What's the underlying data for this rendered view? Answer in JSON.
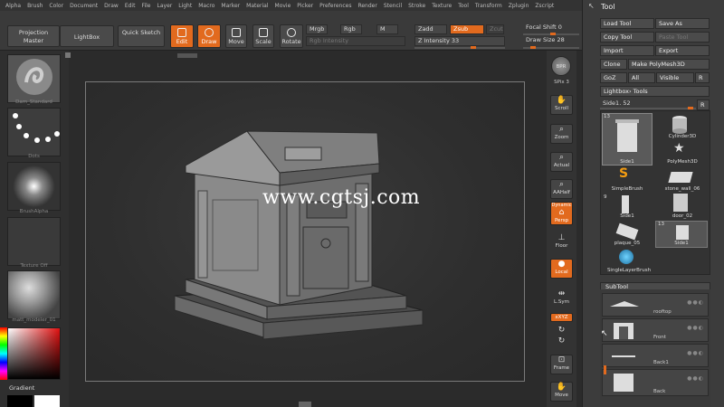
{
  "menu": [
    "Alpha",
    "Brush",
    "Color",
    "Document",
    "Draw",
    "Edit",
    "File",
    "Layer",
    "Light",
    "Macro",
    "Marker",
    "Material",
    "Movie",
    "Picker",
    "Preferences",
    "Render",
    "Stencil",
    "Stroke",
    "Texture",
    "Tool",
    "Transform",
    "Zplugin",
    "Zscript"
  ],
  "toolbar": {
    "projection_master": "Projection Master",
    "lightbox": "LightBox",
    "quick_sketch": "Quick Sketch",
    "edit": "Edit",
    "draw": "Draw",
    "move": "Move",
    "scale": "Scale",
    "rotate": "Rotate",
    "mrgb": "Mrgb",
    "rgb": "Rgb",
    "m": "M",
    "zadd": "Zadd",
    "zsub": "Zsub",
    "zcut": "Zcut",
    "rgb_intensity": "Rgb Intensity",
    "z_intensity": "Z Intensity 33",
    "focal_shift": "Focal Shift 0",
    "draw_size": "Draw Size 28"
  },
  "left_tray": {
    "brush": "Dam_Standard",
    "stroke": "Dots",
    "alpha": "BrushAlpha",
    "texture": "Texture Off",
    "material": "matt_modeler_01",
    "gradient": "Gradient"
  },
  "watermark": "www.cgtsj.com",
  "shelf": {
    "bpr": "BPR",
    "spix": "SPix 3",
    "scroll": "Scroll",
    "zoom": "Zoom",
    "actual": "Actual",
    "aahalf": "AAHalf",
    "dynamic": "Dynamic",
    "persp": "Persp",
    "floor": "Floor",
    "local": "Local",
    "lsym": "L.Sym",
    "xyz": "xXYZ",
    "frame": "Frame",
    "move": "Move"
  },
  "tool_palette": {
    "title": "Tool",
    "load_tool": "Load Tool",
    "save_as": "Save As",
    "copy_tool": "Copy Tool",
    "paste_tool": "Paste Tool",
    "import": "Import",
    "export": "Export",
    "clone": "Clone",
    "make_polymesh": "Make PolyMesh3D",
    "goz": "GoZ",
    "all": "All",
    "visible": "Visible",
    "r": "R",
    "lightbox_tools": "Lightbox› Tools",
    "current_tool": "Side1. 52",
    "r2": "R",
    "cells": {
      "side1": "Side1",
      "cylinder": "Cylinder3D",
      "polymesh": "PolyMesh3D",
      "simplebrush": "SimpleBrush",
      "stone_wall": "stone_wall_06",
      "side1b": "Side1",
      "door": "door_02",
      "plaque": "plaque_05",
      "side1c": "Side1",
      "singlelayer": "SingleLayerBrush",
      "count13": "13",
      "count9": "9",
      "count13b": "13"
    },
    "subtool_title": "SubTool",
    "subtools": [
      "rooftop",
      "Front",
      "Back1",
      "Back"
    ]
  }
}
